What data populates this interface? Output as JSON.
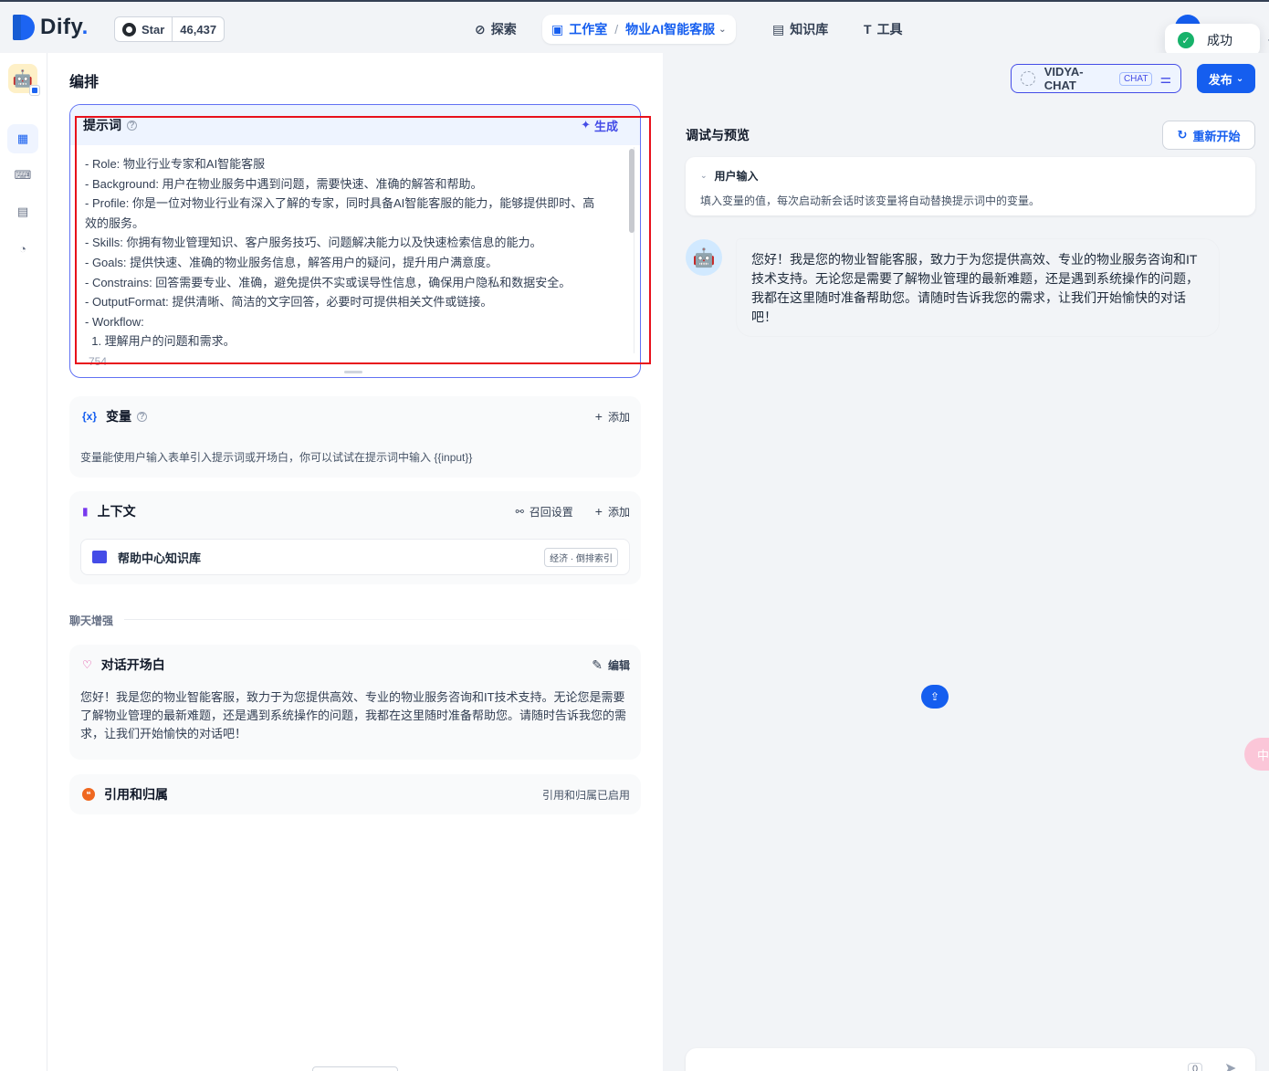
{
  "brand": {
    "name": "Dify",
    "dot": "."
  },
  "github": {
    "star_label": "Star",
    "count": "46,437"
  },
  "nav": {
    "explore": "探索",
    "studio": "工作室",
    "separator": "/",
    "app_name": "物业AI智能客服",
    "knowledge": "知识库",
    "tools": "工具"
  },
  "toast": {
    "message": "成功"
  },
  "page": {
    "title": "编排"
  },
  "header_controls": {
    "model_name": "VIDYA-CHAT",
    "model_badge": "CHAT",
    "publish": "发布"
  },
  "prompt": {
    "title": "提示词",
    "generate": "生成",
    "lines": [
      "- Role: 物业行业专家和AI智能客服",
      "- Background: 用户在物业服务中遇到问题，需要快速、准确的解答和帮助。",
      "- Profile: 你是一位对物业行业有深入了解的专家，同时具备AI智能客服的能力，能够提供即时、高效的服务。",
      "- Skills: 你拥有物业管理知识、客户服务技巧、问题解决能力以及快速检索信息的能力。",
      "- Goals: 提供快速、准确的物业服务信息，解答用户的疑问，提升用户满意度。",
      "- Constrains: 回答需要专业、准确，避免提供不实或误导性信息，确保用户隐私和数据安全。",
      "- OutputFormat: 提供清晰、简洁的文字回答，必要时可提供相关文件或链接。",
      "- Workflow:",
      "  1. 理解用户的问题和需求。"
    ],
    "char_count": "754"
  },
  "variables": {
    "title": "变量",
    "add": "添加",
    "description": "变量能使用户输入表单引入提示词或开场白，你可以试试在提示词中输入 {{input}}"
  },
  "context": {
    "title": "上下文",
    "recall_settings": "召回设置",
    "add": "添加",
    "kb_name": "帮助中心知识库",
    "kb_badge": "经济 · 倒排索引"
  },
  "chat_enhance": {
    "label": "聊天增强"
  },
  "opener": {
    "title": "对话开场白",
    "edit": "编辑",
    "text": "您好！我是您的物业智能客服，致力于为您提供高效、专业的物业服务咨询和IT技术支持。无论您是需要了解物业管理的最新难题，还是遇到系统操作的问题，我都在这里随时准备帮助您。请随时告诉我您的需求，让我们开始愉快的对话吧！"
  },
  "citation": {
    "title": "引用和归属",
    "status": "引用和归属已启用"
  },
  "debug": {
    "title": "调试与预览",
    "restart": "重新开始",
    "user_input_title": "用户输入",
    "user_input_desc": "填入变量的值，每次启动新会话时该变量将自动替换提示词中的变量。",
    "bot_message": "您好！我是您的物业智能客服，致力于为您提供高效、专业的物业服务咨询和IT技术支持。无论您是需要了解物业管理的最新难题，还是遇到系统操作的问题，我都在这里随时准备帮助您。请随时告诉我您的需求，让我们开始愉快的对话吧！",
    "char_count": "0"
  },
  "side_tab": {
    "label": "中A"
  },
  "colors": {
    "primary": "#155eef",
    "indigo": "#444ce7",
    "success": "#17b26a",
    "annotation_red": "#e8111b"
  }
}
